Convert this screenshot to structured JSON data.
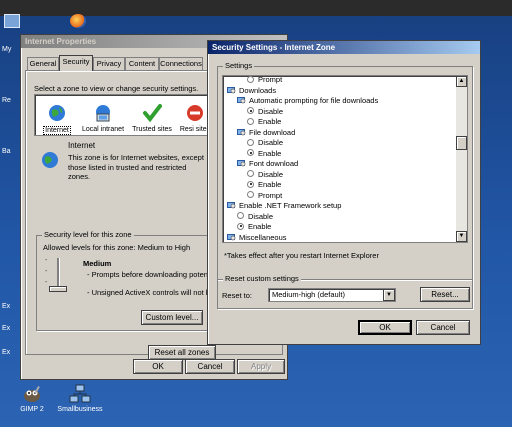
{
  "desktop": {
    "side_labels": [
      "My",
      "Re",
      "Ba",
      "Ex",
      "Ex",
      "Ex"
    ],
    "icons": [
      {
        "label": "GIMP 2",
        "icon": "gimp-icon"
      },
      {
        "label": "Smallbusiness",
        "icon": "network-icon"
      }
    ]
  },
  "internet_properties": {
    "title": "Internet Properties",
    "tabs": [
      "General",
      "Security",
      "Privacy",
      "Content",
      "Connections"
    ],
    "active_tab": "Security",
    "zone_prompt": "Select a zone to view or change security settings.",
    "zones": [
      {
        "label": "Internet",
        "icon": "globe-icon",
        "selected": true
      },
      {
        "label": "Local intranet",
        "icon": "intranet-icon",
        "selected": false
      },
      {
        "label": "Trusted sites",
        "icon": "checkmark-icon",
        "selected": false
      },
      {
        "label": "Resi sites",
        "icon": "restricted-icon",
        "selected": false
      }
    ],
    "zone_title": "Internet",
    "zone_description": "This zone is for Internet websites, except those listed in trusted and restricted zones.",
    "security_level_legend": "Security level for this zone",
    "allowed_levels": "Allowed levels for this zone: Medium to High",
    "level_name": "Medium",
    "level_bullets": [
      "- Prompts before downloading potenti content",
      "- Unsigned ActiveX controls will not be"
    ],
    "slider_ticks": [
      "-",
      "-",
      "-",
      "-"
    ],
    "custom_level_button": "Custom level...",
    "reset_all_button": "Reset all zones",
    "ok": "OK",
    "cancel": "Cancel",
    "apply": "Apply"
  },
  "security_settings": {
    "title": "Security Settings - Internet Zone",
    "settings_legend": "Settings",
    "rows": [
      {
        "type": "radio",
        "label": "Prompt",
        "checked": false,
        "indent": 2
      },
      {
        "type": "header",
        "label": "Downloads",
        "indent": 0
      },
      {
        "type": "header",
        "label": "Automatic prompting for file downloads",
        "indent": 1
      },
      {
        "type": "radio",
        "label": "Disable",
        "checked": true,
        "indent": 2
      },
      {
        "type": "radio",
        "label": "Enable",
        "checked": false,
        "indent": 2
      },
      {
        "type": "header",
        "label": "File download",
        "indent": 1
      },
      {
        "type": "radio",
        "label": "Disable",
        "checked": false,
        "indent": 2
      },
      {
        "type": "radio",
        "label": "Enable",
        "checked": true,
        "indent": 2
      },
      {
        "type": "header",
        "label": "Font download",
        "indent": 1
      },
      {
        "type": "radio",
        "label": "Disable",
        "checked": false,
        "indent": 2
      },
      {
        "type": "radio",
        "label": "Enable",
        "checked": true,
        "indent": 2
      },
      {
        "type": "radio",
        "label": "Prompt",
        "checked": false,
        "indent": 2
      },
      {
        "type": "header",
        "label": "Enable .NET Framework setup",
        "indent": 0
      },
      {
        "type": "radio",
        "label": "Disable",
        "checked": false,
        "indent": 1
      },
      {
        "type": "radio",
        "label": "Enable",
        "checked": true,
        "indent": 1
      },
      {
        "type": "header",
        "label": "Miscellaneous",
        "indent": 0
      }
    ],
    "restart_note": "*Takes effect after you restart Internet Explorer",
    "reset_legend": "Reset custom settings",
    "reset_to_label": "Reset to:",
    "reset_to_value": "Medium-high (default)",
    "reset_button": "Reset...",
    "ok": "OK",
    "cancel": "Cancel"
  }
}
